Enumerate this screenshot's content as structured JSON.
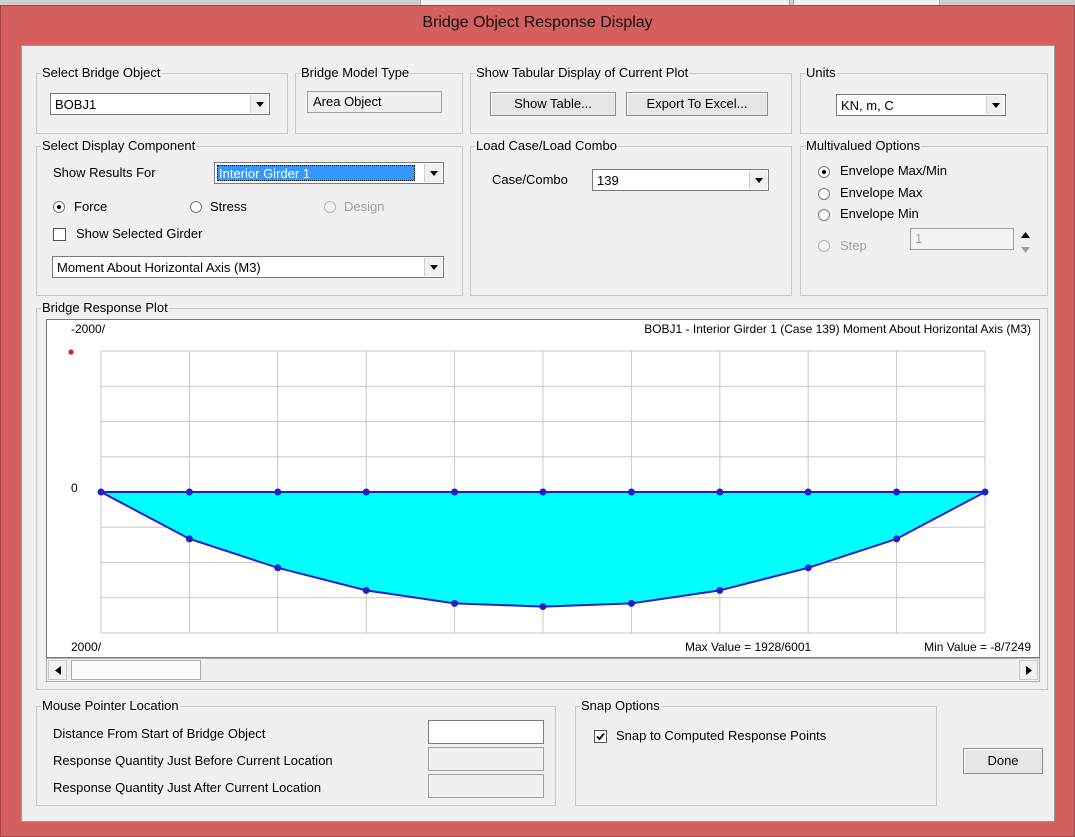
{
  "window": {
    "title": "Bridge Object Response Display"
  },
  "select_bridge_object": {
    "legend": "Select Bridge Object",
    "value": "BOBJ1"
  },
  "bridge_model_type": {
    "legend": "Bridge Model Type",
    "value": "Area Object"
  },
  "tabular": {
    "legend": "Show Tabular Display of Current Plot",
    "show_table": "Show Table...",
    "export_excel": "Export To Excel..."
  },
  "units": {
    "legend": "Units",
    "value": "KN, m, C"
  },
  "display_component": {
    "legend": "Select Display Component",
    "show_results_label": "Show Results For",
    "show_results_value": "Interior Girder 1",
    "radios": [
      {
        "label": "Force",
        "checked": true,
        "enabled": true
      },
      {
        "label": "Stress",
        "checked": false,
        "enabled": true
      },
      {
        "label": "Design",
        "checked": false,
        "enabled": false
      }
    ],
    "show_selected_girder": "Show Selected Girder",
    "component_value": "Moment About Horizontal Axis  (M3)"
  },
  "load_case": {
    "legend": "Load Case/Load Combo",
    "label": "Case/Combo",
    "value": "139"
  },
  "multivalued": {
    "legend": "Multivalued Options",
    "options": [
      {
        "label": "Envelope Max/Min",
        "checked": true,
        "enabled": true
      },
      {
        "label": "Envelope Max",
        "checked": false,
        "enabled": true
      },
      {
        "label": "Envelope Min",
        "checked": false,
        "enabled": true
      },
      {
        "label": "Step",
        "checked": false,
        "enabled": false
      }
    ],
    "step_value": "1"
  },
  "plot": {
    "legend": "Bridge Response Plot",
    "top_label": "-2000/",
    "zero_label": "0",
    "bottom_label": "2000/",
    "caption": "BOBJ1 - Interior Girder 1   (Case 139)   Moment About Horizontal Axis  (M3)",
    "max_value": "Max Value = 1928/6001",
    "min_value": "Min Value = -8/7249",
    "fill_color": "#00ffff",
    "line_color": "#2020c8",
    "grid_color": "#c8c8c8"
  },
  "chart_data": {
    "type": "area",
    "x": [
      0,
      1,
      2,
      3,
      4,
      5,
      6,
      7,
      8,
      9,
      10
    ],
    "values": [
      0,
      665,
      1075,
      1395,
      1580,
      1625,
      1580,
      1395,
      1075,
      665,
      0
    ],
    "ylim": [
      -2000,
      2000
    ],
    "y_inverted": true,
    "grid": true,
    "title": "BOBJ1 - Interior Girder 1   (Case 139)   Moment About Horizontal Axis  (M3)"
  },
  "mouse_pointer": {
    "legend": "Mouse Pointer Location",
    "labels": [
      "Distance From Start of Bridge Object",
      "Response Quantity Just Before Current Location",
      "Response Quantity Just After Current Location"
    ]
  },
  "snap": {
    "legend": "Snap Options",
    "label": "Snap to Computed Response Points",
    "checked": true
  },
  "done_button": "Done",
  "icons": {
    "dropdown": "chevron-down-icon",
    "scroll_left": "arrow-left-icon",
    "scroll_right": "arrow-right-icon",
    "spin_up": "spin-up-icon",
    "spin_down": "spin-down-icon",
    "check": "checkmark-icon"
  }
}
